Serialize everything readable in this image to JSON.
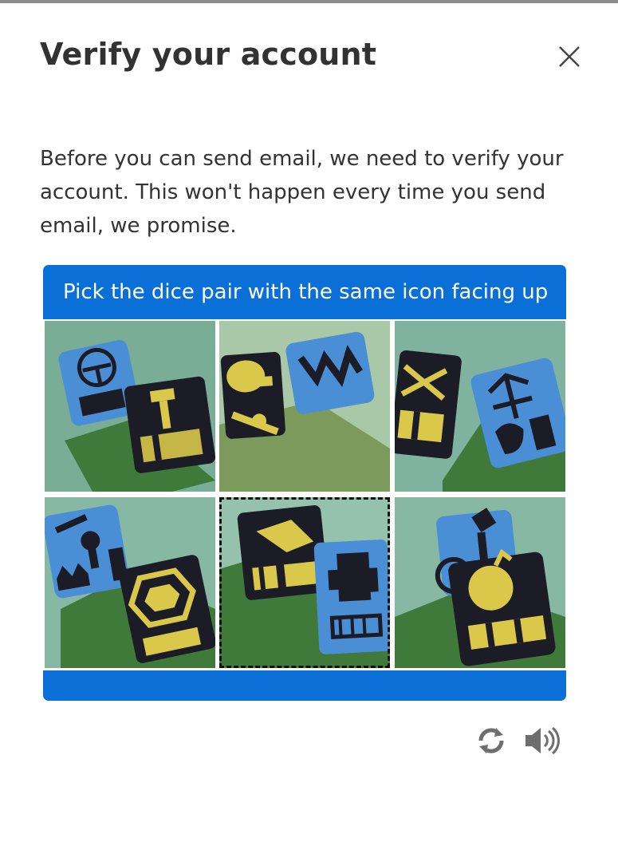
{
  "dialog": {
    "title": "Verify your account",
    "description": "Before you can send email, we need to verify your account. This won't happen every time you send email, we promise."
  },
  "challenge": {
    "prompt": "Pick the dice pair with the same icon facing up",
    "tiles": [
      {
        "label": "dice-pair-1",
        "selected": false
      },
      {
        "label": "dice-pair-2",
        "selected": false
      },
      {
        "label": "dice-pair-3",
        "selected": false
      },
      {
        "label": "dice-pair-4",
        "selected": false
      },
      {
        "label": "dice-pair-5",
        "selected": true
      },
      {
        "label": "dice-pair-6",
        "selected": false
      }
    ]
  },
  "controls": {
    "refresh_icon": "refresh-icon",
    "audio_icon": "speaker-icon"
  },
  "colors": {
    "accent": "#0b6fd8",
    "die_blue": "#4a8fd6",
    "die_black": "#1c1c26",
    "symbol_yellow": "#d9c84a"
  }
}
